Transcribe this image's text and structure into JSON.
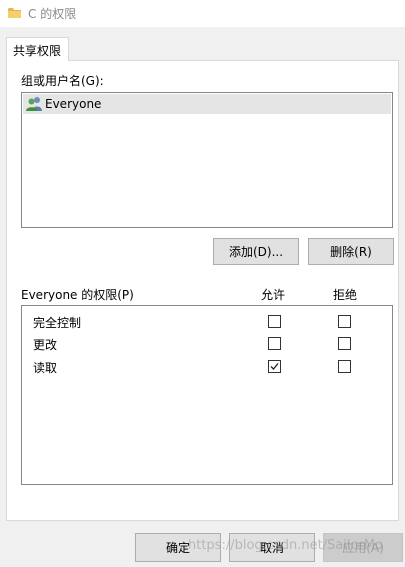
{
  "window": {
    "title": "C 的权限",
    "icon": "folder-icon"
  },
  "tabs": [
    {
      "label": "共享权限",
      "active": true
    }
  ],
  "group_section": {
    "label": "组或用户名(G):",
    "users": [
      {
        "name": "Everyone",
        "icon": "users-icon",
        "selected": true
      }
    ]
  },
  "buttons": {
    "add": "添加(D)...",
    "remove": "删除(R)"
  },
  "permissions": {
    "label": "Everyone 的权限(P)",
    "allow_header": "允许",
    "deny_header": "拒绝",
    "rows": [
      {
        "name": "完全控制",
        "allow": false,
        "deny": false
      },
      {
        "name": "更改",
        "allow": false,
        "deny": false
      },
      {
        "name": "读取",
        "allow": true,
        "deny": false
      }
    ]
  },
  "footer": {
    "ok": "确定",
    "cancel": "取消",
    "apply": "应用(A)"
  },
  "watermark": "https://blog.csdn.net/SailorMo",
  "colors": {
    "dialog_bg": "#f0f0f0",
    "button_bg": "#e1e1e1",
    "selection_bg": "#e5e5e5",
    "folder": "#e8b64c"
  }
}
